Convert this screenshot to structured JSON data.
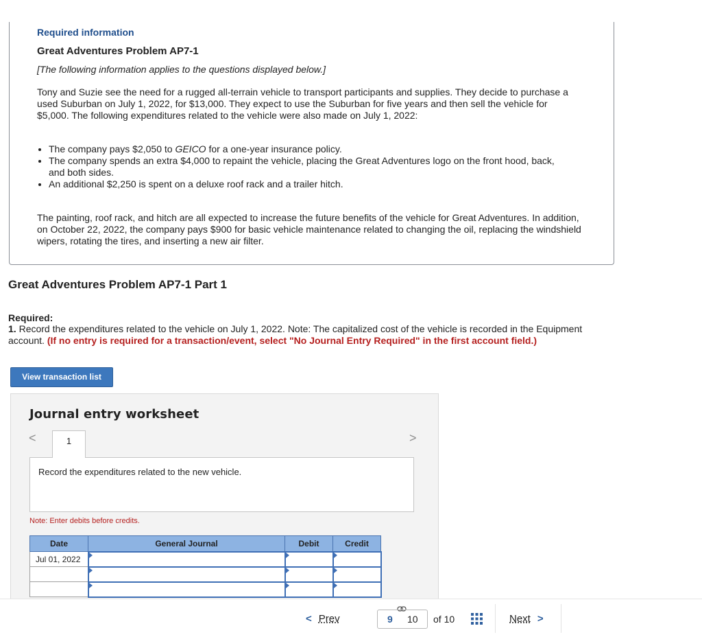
{
  "info": {
    "required_information": "Required information",
    "problem_title": "Great Adventures Problem AP7-1",
    "applies_note": "[The following information applies to the questions displayed below.]",
    "paragraph1": "Tony and Suzie see the need for a rugged all-terrain vehicle to transport participants and supplies. They decide to purchase a used Suburban on July 1, 2022, for $13,000. They expect to use the Suburban for five years and then sell the vehicle for $5,000. The following expenditures related to the vehicle were also made on July 1, 2022:",
    "bullets": [
      {
        "before": "The company pays $2,050 to ",
        "italic": "GEICO",
        "after": " for a one-year insurance policy."
      },
      {
        "text": "The company spends an extra $4,000 to repaint the vehicle, placing the Great Adventures logo on the front hood, back, and both sides."
      },
      {
        "text": "An additional $2,250 is spent on a deluxe roof rack and a trailer hitch."
      }
    ],
    "paragraph2": "The painting, roof rack, and hitch are all expected to increase the future benefits of the vehicle for Great Adventures. In addition, on October 22, 2022, the company pays $900 for basic vehicle maintenance related to changing the oil, replacing the windshield wipers, rotating the tires, and inserting a new air filter."
  },
  "part": {
    "title": "Great Adventures Problem AP7-1 Part 1",
    "required_label": "Required:",
    "required_number": "1.",
    "required_text": " Record the expenditures related to the vehicle on July 1, 2022. Note: The capitalized cost of the vehicle is recorded in the Equipment account. ",
    "required_red": "(If no entry is required for a transaction/event, select \"No Journal Entry Required\" in the first account field.)"
  },
  "view_button": "View transaction list",
  "worksheet": {
    "title": "Journal entry worksheet",
    "tab": "1",
    "left_arrow": "<",
    "right_arrow": ">",
    "instruction": "Record the expenditures related to the new vehicle.",
    "note": "Note: Enter debits before credits.",
    "columns": {
      "date": "Date",
      "journal": "General Journal",
      "debit": "Debit",
      "credit": "Credit"
    },
    "rows": [
      {
        "date": "Jul 01, 2022",
        "journal": "",
        "debit": "",
        "credit": ""
      },
      {
        "date": "",
        "journal": "",
        "debit": "",
        "credit": ""
      },
      {
        "date": "",
        "journal": "",
        "debit": "",
        "credit": ""
      }
    ]
  },
  "footer": {
    "prev": "Prev",
    "prev_chevron": "<",
    "page_number": "9",
    "current_page": "10",
    "of_total": "of 10",
    "next": "Next",
    "next_chevron": ">"
  },
  "colors": {
    "accent": "#3d78bd",
    "header_blue": "#8db3e2",
    "warning_red": "#b5201f",
    "link_blue": "#1f4e8c"
  },
  "icons": [
    "link-icon",
    "grid-icon",
    "chevron-left-icon",
    "chevron-right-icon"
  ]
}
